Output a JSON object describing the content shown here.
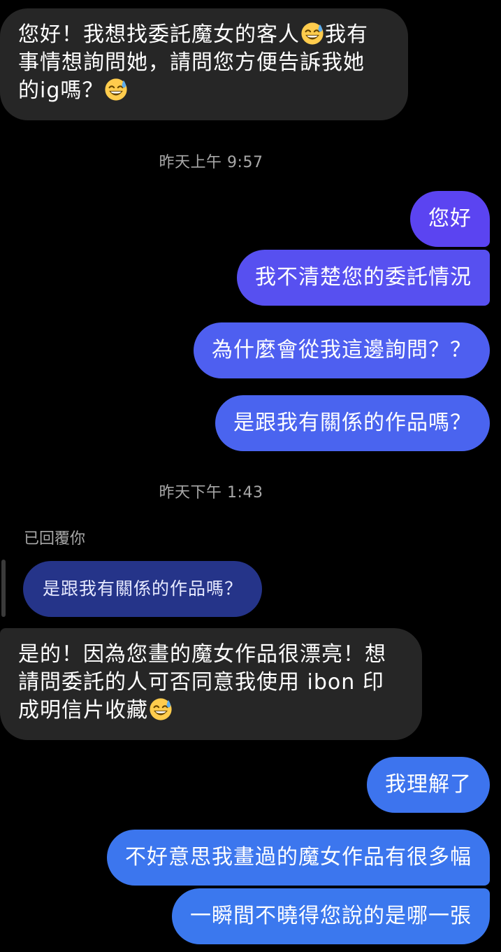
{
  "messages": {
    "m1": {
      "line1_text": "您好！我想找委託魔女的客人",
      "line1_tail": "我有",
      "line2": "事情想詢問她，請問您方便告訴我她",
      "line3_text": "的ig嗎？"
    },
    "ts1": "昨天上午 9:57",
    "o1": "您好",
    "o2": "我不清楚您的委託情況",
    "o3": "為什麼會從我這邊詢問？？",
    "o4": "是跟我有關係的作品嗎？",
    "ts2": "昨天下午 1:43",
    "reply_label": "已回覆你",
    "quoted": "是跟我有關係的作品嗎？",
    "m2": {
      "line1": "是的！因為您畫的魔女作品很漂亮！想",
      "line2": "請問委託的人可否同意我使用 ibon 印",
      "line3_text": "成明信片收藏"
    },
    "o5": "我理解了",
    "o6": "不好意思我畫過的魔女作品有很多幅",
    "o7": "一瞬間不曉得您說的是哪一張"
  },
  "icons": {
    "emoji": "grinning-face-with-sweat-icon"
  },
  "colors": {
    "background": "#000000",
    "incoming_bubble": "#262626",
    "outgoing_purple": "#5a45f0",
    "outgoing_blue": "#3f72ee",
    "quoted_bubble": "#253489",
    "timestamp": "#a8a8a8"
  }
}
